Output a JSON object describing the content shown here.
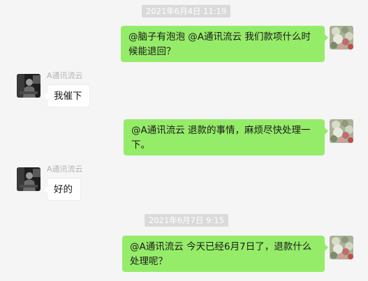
{
  "messages": [
    {
      "kind": "timestamp",
      "text": "2021年6月4日 11:19"
    },
    {
      "kind": "outgoing",
      "text": "@脑子有泡泡 @A通讯流云 我们款项什么时候能退回？",
      "avatar": "flower-bouquet-avatar"
    },
    {
      "kind": "incoming",
      "sender": "A通讯流云",
      "text": "我催下",
      "avatar": "person-photo-avatar"
    },
    {
      "kind": "outgoing",
      "text": "@A通讯流云 退款的事情，麻烦尽快处理一下。",
      "avatar": "flower-bouquet-avatar"
    },
    {
      "kind": "incoming",
      "sender": "A通讯流云",
      "text": "好的",
      "avatar": "person-photo-avatar"
    },
    {
      "kind": "timestamp",
      "text": "2021年6月7日 9:15"
    },
    {
      "kind": "outgoing",
      "text": "@A通讯流云 今天已经6月7日了，退款什么处理呢？",
      "avatar": "flower-bouquet-avatar"
    }
  ],
  "colors": {
    "background": "#f5f5f5",
    "outgoing_bubble": "#95ec69",
    "incoming_bubble": "#ffffff",
    "timestamp_badge": "#dadada",
    "sender_name": "#b3b3b3"
  }
}
